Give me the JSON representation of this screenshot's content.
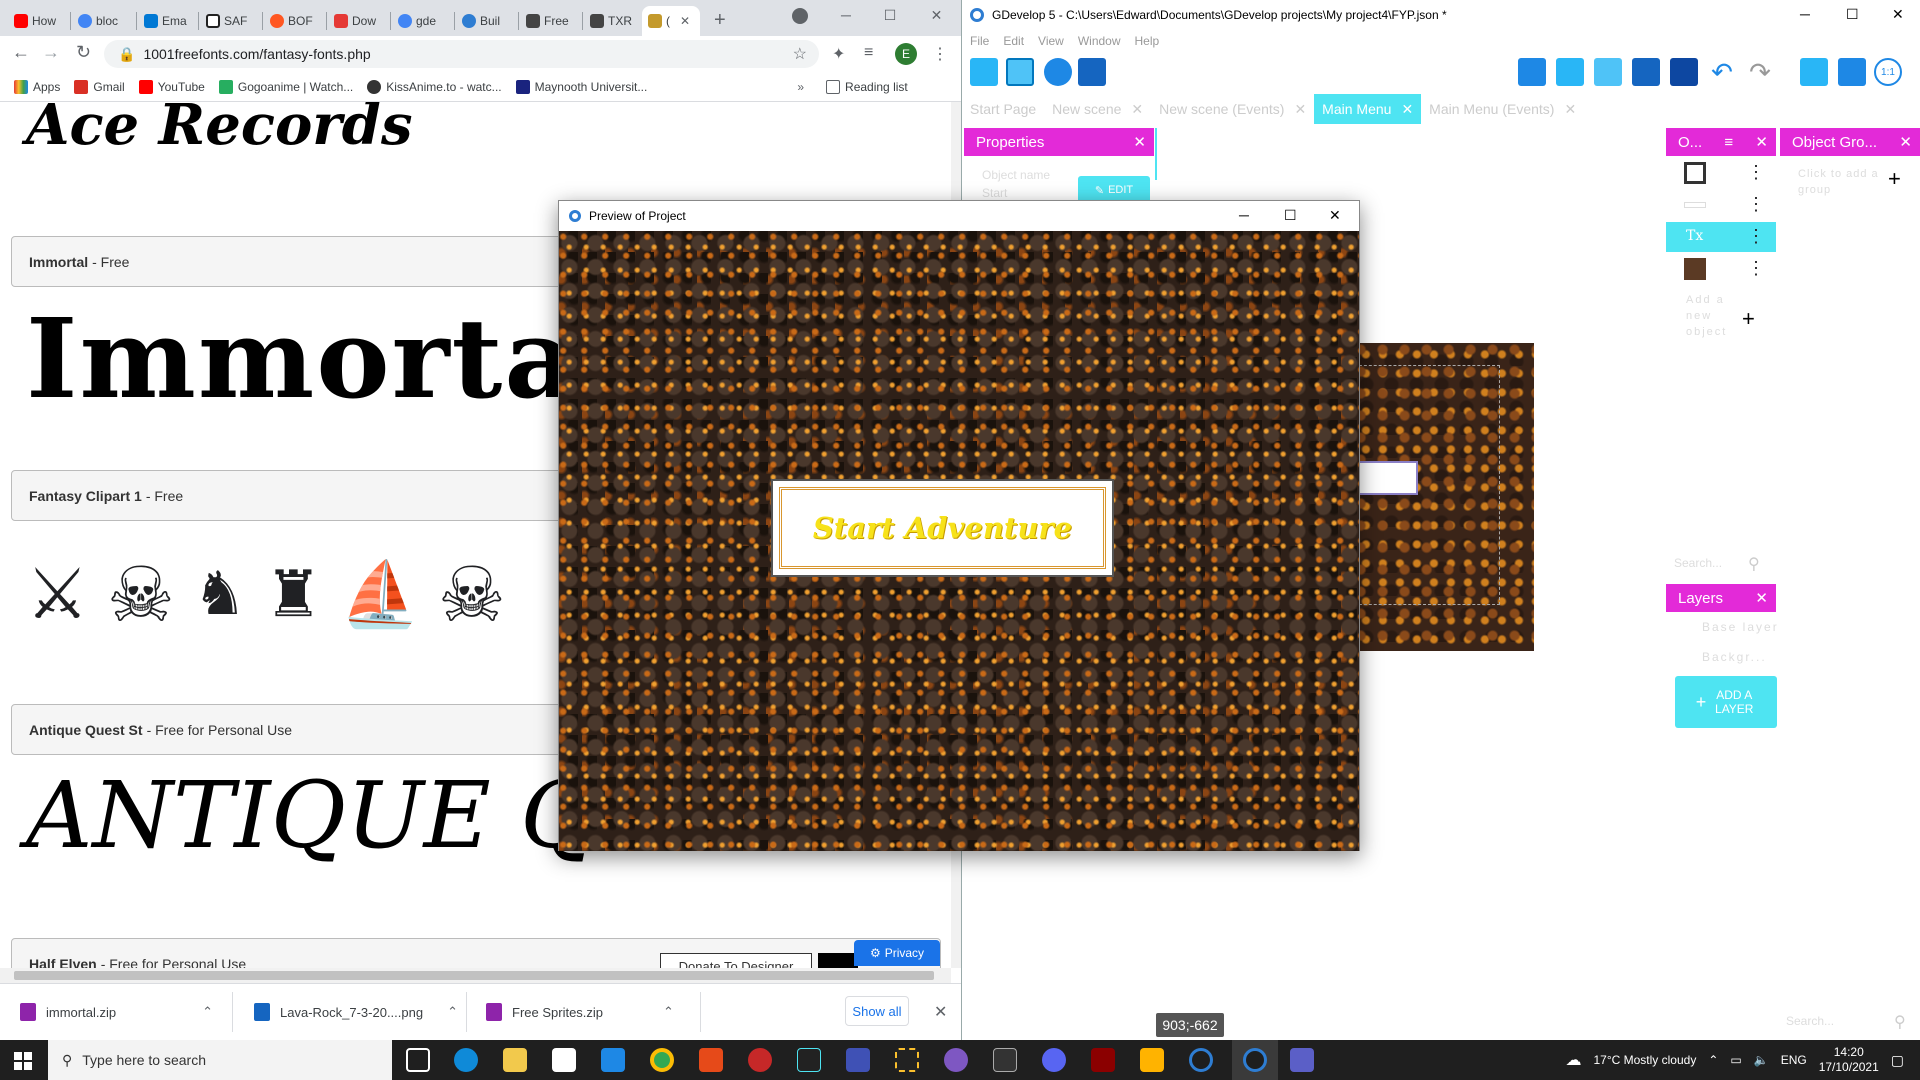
{
  "chrome": {
    "tabs": [
      {
        "label": "How",
        "color": "#ff0000"
      },
      {
        "label": "bloc",
        "color": "#4285f4"
      },
      {
        "label": "Ema",
        "color": "#0078d4"
      },
      {
        "label": "SAF",
        "color": "#222222"
      },
      {
        "label": "BOF",
        "color": "#ff5722"
      },
      {
        "label": "Dow",
        "color": "#e53935"
      },
      {
        "label": "gde",
        "color": "#4285f4"
      },
      {
        "label": "Buil",
        "color": "#2e7dd2"
      },
      {
        "label": "Free",
        "color": "#444444"
      },
      {
        "label": "TXR",
        "color": "#444444"
      },
      {
        "label": "(",
        "color": "#c49a2c"
      }
    ],
    "url": "1001freefonts.com/fantasy-fonts.php",
    "avatar_letter": "E",
    "bookmarks": [
      {
        "label": "Apps",
        "color": "#e53935"
      },
      {
        "label": "Gmail",
        "color": "#d93025"
      },
      {
        "label": "YouTube",
        "color": "#ff0000"
      },
      {
        "label": "Gogoanime | Watch...",
        "color": "#27ae60"
      },
      {
        "label": "KissAnime.to - watc...",
        "color": "#333333"
      },
      {
        "label": "Maynooth Universit...",
        "color": "#1a237e"
      }
    ],
    "reading_list": "Reading list",
    "fonts": [
      {
        "name": "Immortal",
        "license": "- Free",
        "preview": "Immorta"
      },
      {
        "name": "Fantasy Clipart 1",
        "license": "- Free"
      },
      {
        "name": "Antique Quest St",
        "license": "- Free for Personal Use",
        "preview": "ANTIQUE Q"
      },
      {
        "name": "Half Elven",
        "license": "- Free for Personal Use"
      }
    ],
    "top_preview": "Ace Records",
    "donate_label": "Donate To Designer",
    "privacy_label": "Privacy",
    "downloads": [
      {
        "name": "immortal.zip",
        "color": "#8e24aa"
      },
      {
        "name": "Lava-Rock_7-3-20....png",
        "color": "#1565c0"
      },
      {
        "name": "Free Sprites.zip",
        "color": "#8e24aa"
      }
    ],
    "show_all": "Show all"
  },
  "gdevelop": {
    "title": "GDevelop 5 - C:\\Users\\Edward\\Documents\\GDevelop projects\\My project4\\FYP.json *",
    "menu": [
      "File",
      "Edit",
      "View",
      "Window",
      "Help"
    ],
    "tabs": [
      {
        "label": "Start Page",
        "active": false
      },
      {
        "label": "New scene",
        "active": false
      },
      {
        "label": "New scene (Events)",
        "active": false
      },
      {
        "label": "Main Menu",
        "active": true
      },
      {
        "label": "Main Menu (Events)",
        "active": false
      }
    ],
    "properties_title": "Properties",
    "object_name_label": "Object name",
    "object_name_value": "Start",
    "edit_label": "EDIT",
    "objects_title": "O...",
    "object_groups_title": "Object Gro...",
    "add_group_hint": "Click to add a group",
    "add_object_hint": "Add a new object",
    "layers_title": "Layers",
    "layer_base": "Base layer",
    "layer_background": "Backgr...",
    "add_layer_label": "ADD A LAYER",
    "search_hint": "Search...",
    "coords": "903;-662"
  },
  "preview": {
    "title": "Preview of Project",
    "button_label": "Start  Adventure"
  },
  "taskbar": {
    "search_placeholder": "Type here to search",
    "weather": "17°C  Mostly cloudy",
    "lang": "ENG",
    "time": "14:20",
    "date": "17/10/2021"
  }
}
